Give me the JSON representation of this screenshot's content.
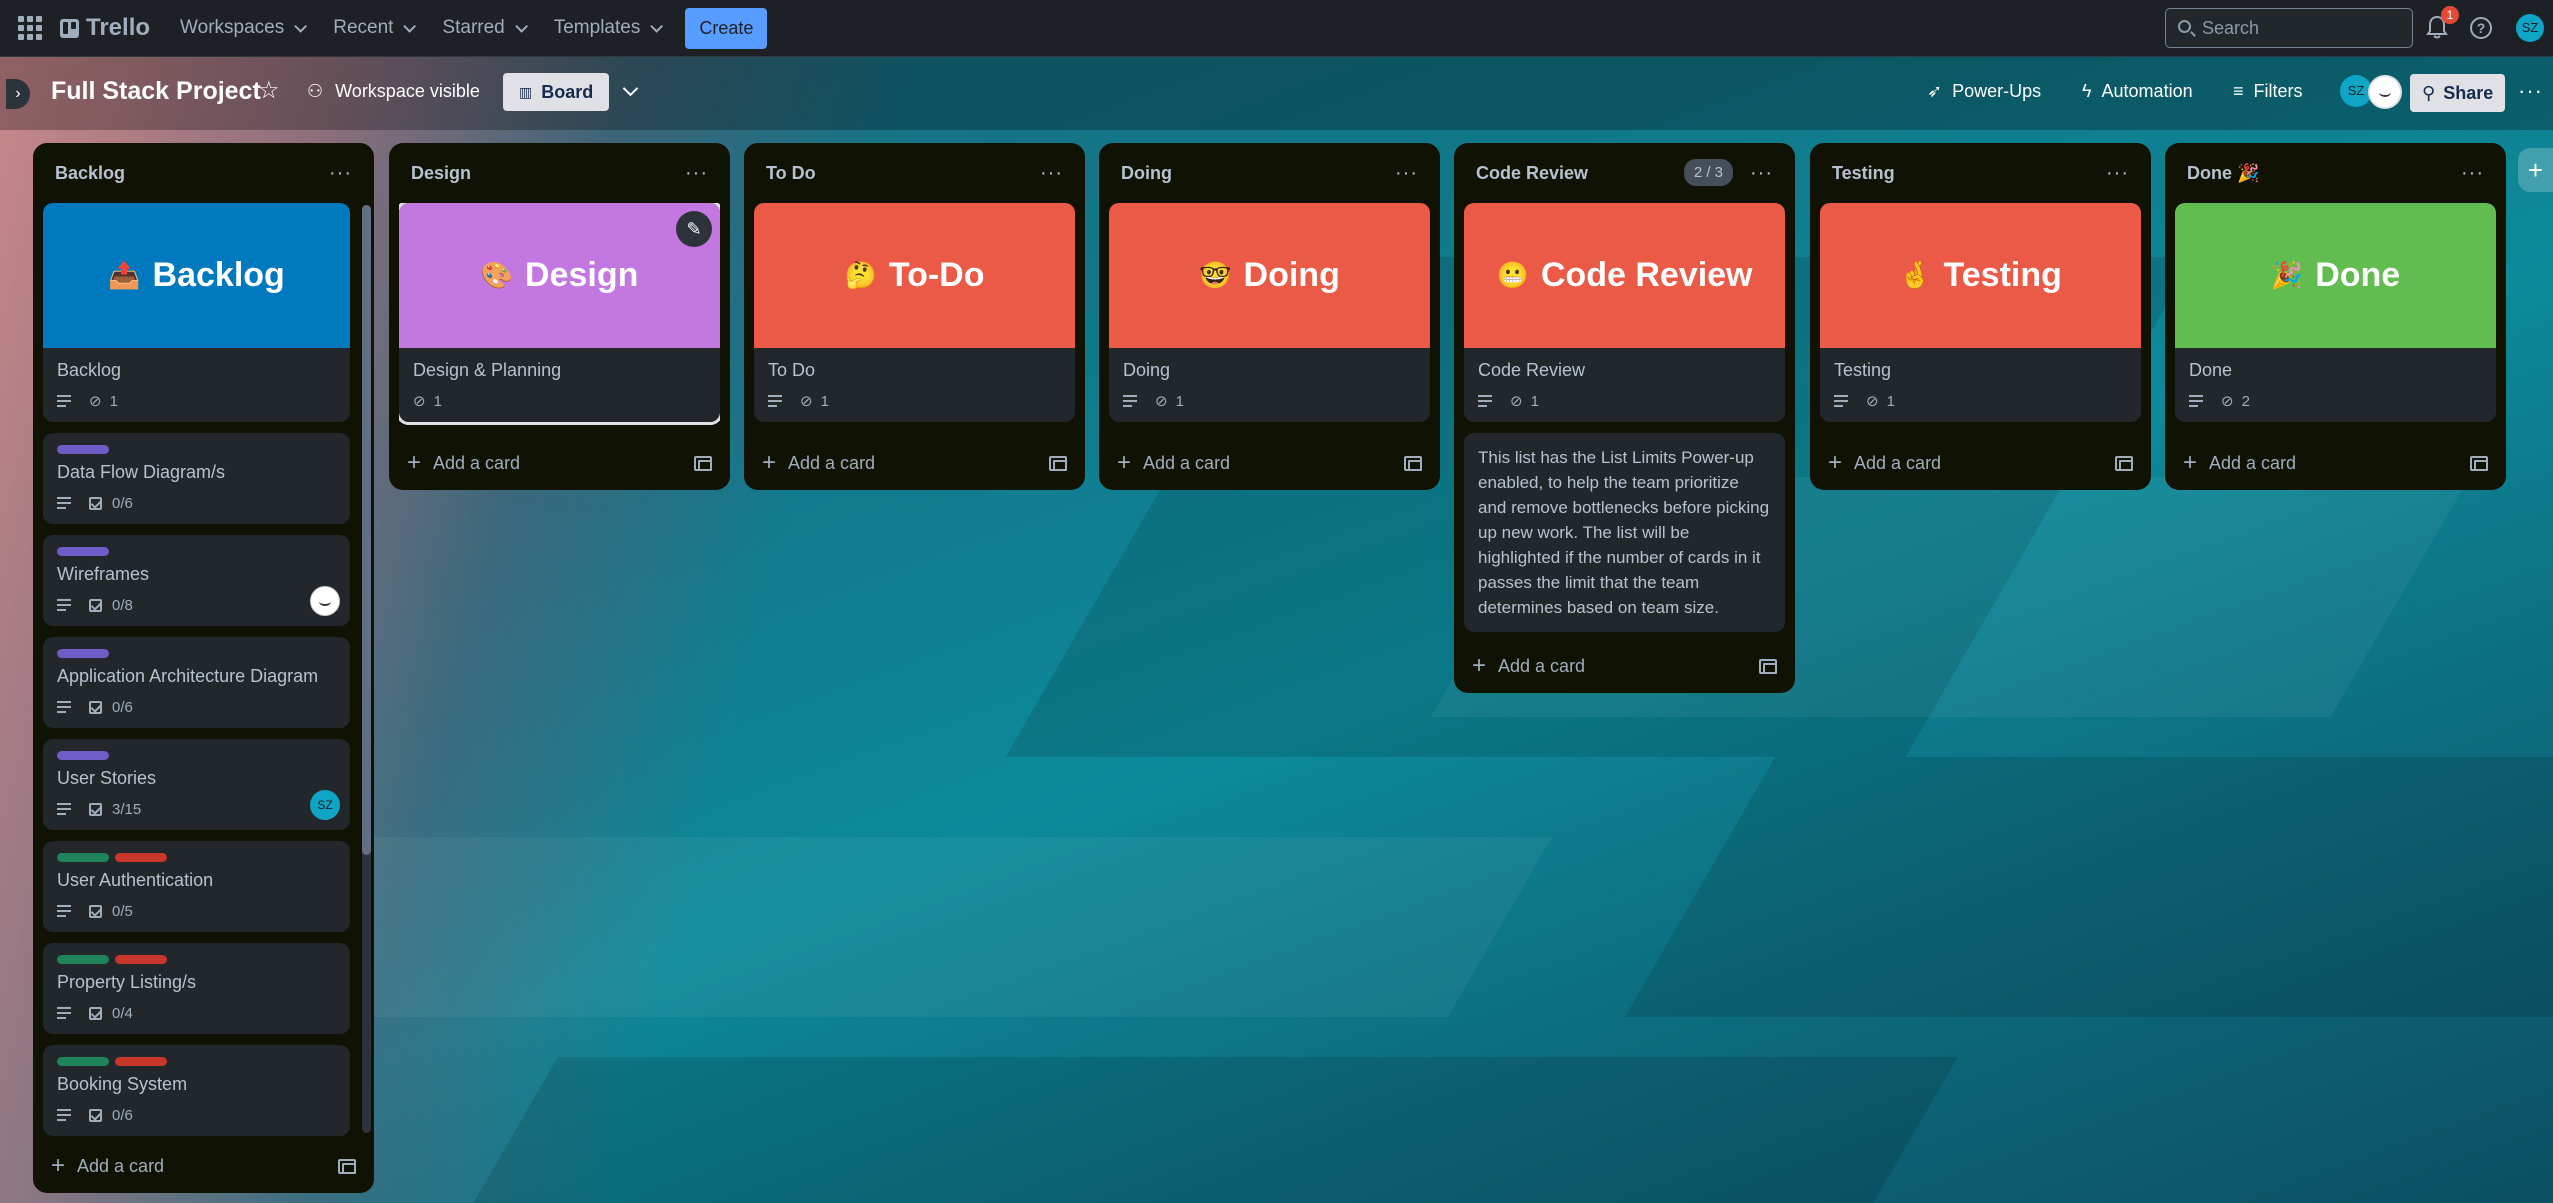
{
  "topnav": {
    "brand": "Trello",
    "menus": [
      "Workspaces",
      "Recent",
      "Starred",
      "Templates"
    ],
    "create_label": "Create",
    "search_placeholder": "Search",
    "notification_count": "1",
    "help_glyph": "?",
    "user_initials": "SZ"
  },
  "board": {
    "title": "Full Stack Project",
    "visibility": "Workspace visible",
    "view_label": "Board",
    "powerups_label": "Power-Ups",
    "automation_label": "Automation",
    "filters_label": "Filters",
    "member_initials": "SZ",
    "share_label": "Share"
  },
  "lists": [
    {
      "title": "Backlog",
      "add_card": "Add a card",
      "cards": [
        {
          "cover_color": "#0079bf",
          "cover_emoji": "📤",
          "cover_text": "Backlog",
          "title": "Backlog",
          "has_desc": true,
          "attachments": "1"
        },
        {
          "labels": [
            "#6e5dc6"
          ],
          "title": "Data Flow Diagram/s",
          "has_desc": true,
          "checklist": "0/6"
        },
        {
          "labels": [
            "#6e5dc6"
          ],
          "title": "Wireframes",
          "has_desc": true,
          "checklist": "0/8",
          "avatar": "face"
        },
        {
          "labels": [
            "#6e5dc6"
          ],
          "title": "Application Architecture Diagram",
          "has_desc": true,
          "checklist": "0/6"
        },
        {
          "labels": [
            "#6e5dc6"
          ],
          "title": "User Stories",
          "has_desc": true,
          "checklist": "3/15",
          "avatar": "SZ"
        },
        {
          "labels": [
            "#1f845a",
            "#c9372c"
          ],
          "title": "User Authentication",
          "has_desc": true,
          "checklist": "0/5"
        },
        {
          "labels": [
            "#1f845a",
            "#c9372c"
          ],
          "title": "Property Listing/s",
          "has_desc": true,
          "checklist": "0/4"
        },
        {
          "labels": [
            "#1f845a",
            "#c9372c"
          ],
          "title": "Booking System",
          "has_desc": true,
          "checklist": "0/6"
        }
      ]
    },
    {
      "title": "Design",
      "add_card": "Add a card",
      "cards": [
        {
          "cover_color": "#c377e0",
          "cover_emoji": "🎨",
          "cover_text": "Design",
          "title": "Design & Planning",
          "attachments": "1",
          "selected": true
        }
      ]
    },
    {
      "title": "To Do",
      "add_card": "Add a card",
      "cards": [
        {
          "cover_color": "#eb5a46",
          "cover_emoji": "🤔",
          "cover_text": "To-Do",
          "title": "To Do",
          "has_desc": true,
          "attachments": "1"
        }
      ]
    },
    {
      "title": "Doing",
      "add_card": "Add a card",
      "cards": [
        {
          "cover_color": "#eb5a46",
          "cover_emoji": "🤓",
          "cover_text": "Doing",
          "title": "Doing",
          "has_desc": true,
          "attachments": "1"
        }
      ]
    },
    {
      "title": "Code Review",
      "limit": "2 / 3",
      "add_card": "Add a card",
      "cards": [
        {
          "cover_color": "#eb5a46",
          "cover_emoji": "😬",
          "cover_text": "Code Review",
          "title": "Code Review",
          "has_desc": true,
          "attachments": "1"
        },
        {
          "note": "This list has the List Limits Power-up enabled, to help the team prioritize and remove bottlenecks before picking up new work. The list will be highlighted if the number of cards in it passes the limit that the team determines based on team size."
        }
      ]
    },
    {
      "title": "Testing",
      "add_card": "Add a card",
      "cards": [
        {
          "cover_color": "#eb5a46",
          "cover_emoji": "🤞",
          "cover_text": "Testing",
          "title": "Testing",
          "has_desc": true,
          "attachments": "1"
        }
      ]
    },
    {
      "title": "Done 🎉",
      "add_card": "Add a card",
      "cards": [
        {
          "cover_color": "#61bd4f",
          "cover_emoji": "🎉",
          "cover_text": "Done",
          "title": "Done",
          "has_desc": true,
          "attachments": "2"
        }
      ]
    }
  ]
}
